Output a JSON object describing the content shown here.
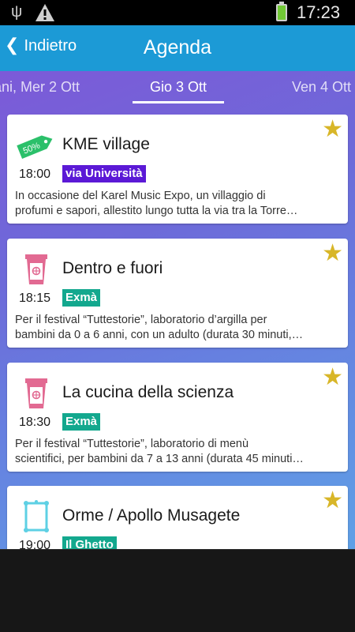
{
  "status": {
    "time": "17:23"
  },
  "appbar": {
    "back_label": "Indietro",
    "title": "Agenda"
  },
  "days": {
    "prev": "ani, Mer 2 Ott",
    "current": "Gio 3 Ott",
    "next": "Ven 4 Ott"
  },
  "colors": {
    "appbar": "#1c9ad6",
    "loc_purple": "#5b19d6",
    "loc_teal": "#13a88e",
    "star": "#d8b628"
  },
  "events": [
    {
      "title": "KME village",
      "time": "18:00",
      "location": "via Università",
      "location_color": "#5b19d6",
      "icon": "discount-tag-icon",
      "tag_text": "50%",
      "desc1": "In occasione del Karel Music Expo, un villaggio di",
      "desc2": "profumi e sapori, allestito lungo tutta la via tra la Torre…"
    },
    {
      "title": "Dentro e fuori",
      "time": "18:15",
      "location": "Exmà",
      "location_color": "#13a88e",
      "icon": "museum-pass-icon",
      "desc1": "Per il festival “Tuttestorie”, laboratorio d’argilla per",
      "desc2": "bambini da 0 a 6 anni, con un adulto (durata 30 minuti,…"
    },
    {
      "title": "La cucina della scienza",
      "time": "18:30",
      "location": "Exmà",
      "location_color": "#13a88e",
      "icon": "museum-pass-icon",
      "desc1": "Per il festival “Tuttestorie”, laboratorio di menù",
      "desc2": "scientifici, per bambini da 7 a 13 anni (durata 45 minuti…"
    },
    {
      "title": "Orme / Apollo Musagete",
      "time": "19:00",
      "location": "Il Ghetto",
      "location_color": "#13a88e",
      "icon": "picture-frame-icon",
      "desc1": "",
      "desc2": ""
    }
  ]
}
